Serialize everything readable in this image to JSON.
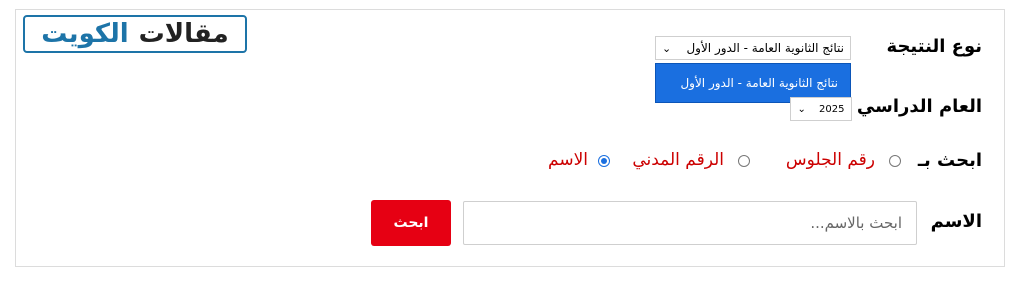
{
  "logo": {
    "word1": "الكويت",
    "word2": "مقالات"
  },
  "form": {
    "result_type": {
      "label": "نوع النتيجة",
      "selected": "نتائج الثانوية العامة - الدور الأول",
      "chevron": "⌄",
      "options": [
        "نتائج الثانوية العامة - الدور الأول"
      ]
    },
    "year": {
      "label": "العام الدراسي",
      "selected": "2025",
      "chevron": "⌄"
    },
    "search_by": {
      "label": "ابحث بـ",
      "options": [
        {
          "label": "رقم الجلوس",
          "checked": false
        },
        {
          "label": "الرقم المدني",
          "checked": false
        },
        {
          "label": "الاسم",
          "checked": true
        }
      ]
    },
    "name": {
      "label": "الاسم",
      "placeholder": "ابحث بالاسم..."
    },
    "submit_label": "ابحث"
  },
  "colors": {
    "accent_blue": "#1a6fe0",
    "logo_blue": "#1d74a8",
    "button_red": "#e60013",
    "radio_label_red": "#cc0000"
  }
}
